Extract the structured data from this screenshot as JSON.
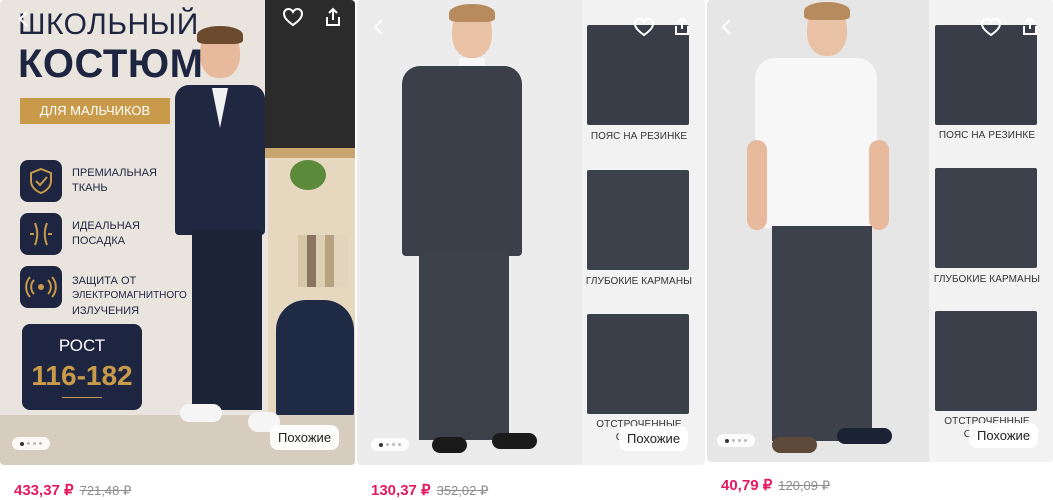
{
  "cards": [
    {
      "banner": {
        "title1": "ШКОЛЬНЫЙ",
        "title2": "КОСТЮМ",
        "tag": "ДЛЯ МАЛЬЧИКОВ",
        "features": [
          {
            "icon": "shield-check-icon",
            "text1": "ПРЕМИАЛЬНАЯ",
            "text2": "ТКАНЬ",
            "text3": ""
          },
          {
            "icon": "body-fit-icon",
            "text1": "ИДЕАЛЬНАЯ",
            "text2": "ПОСАДКА",
            "text3": ""
          },
          {
            "icon": "radiation-shield-icon",
            "text1": "ЗАЩИТА ОТ",
            "text2": "ЭЛЕКТРОМАГНИТНОГО",
            "text3": "ИЗЛУЧЕНИЯ"
          }
        ],
        "height_label": "РОСТ",
        "height_value": "116-182"
      },
      "similar_label": "Похожие",
      "price": "433,37 ₽",
      "old_price": "721,48 ₽"
    },
    {
      "labels": [
        "ПОЯС НА РЕЗИНКЕ",
        "ГЛУБОКИЕ КАРМАНЫ",
        "ОТСТРОЧЕННЫЕ",
        "СТРЕЛКИ"
      ],
      "similar_label": "Похожие",
      "price": "130,37 ₽",
      "old_price": "352,02 ₽"
    },
    {
      "labels": [
        "ПОЯС НА РЕЗИНКЕ",
        "ГЛУБОКИЕ КАРМАНЫ",
        "ОТСТРОЧЕННЫЕ",
        "СТРЕЛКИ"
      ],
      "similar_label": "Похожие",
      "price": "40,79 ₽",
      "old_price": "120,09 ₽"
    }
  ],
  "colors": {
    "price": "#e5195f",
    "navy": "#1d2540",
    "gold": "#c99a4a",
    "suit": "#3a3f4a"
  }
}
